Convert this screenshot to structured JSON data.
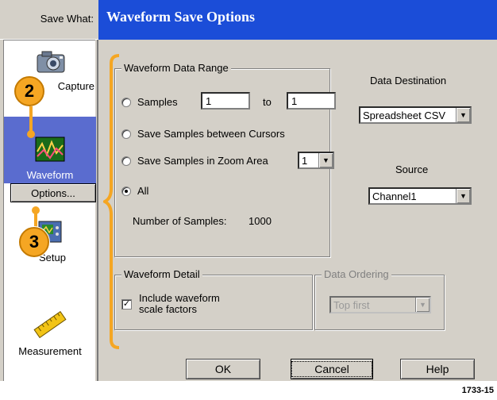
{
  "left_panel": {
    "save_what_label": "Save What:",
    "items": [
      {
        "label": "Capture",
        "icon": "camera-icon"
      },
      {
        "label": "Waveform",
        "icon": "waveform-icon"
      },
      {
        "label": "Setup",
        "icon": "setup-icon"
      },
      {
        "label": "Measurement",
        "icon": "ruler-icon"
      }
    ],
    "options_button": "Options..."
  },
  "dialog": {
    "title": "Waveform Save Options",
    "range_group": {
      "title": "Waveform Data Range",
      "samples_label": "Samples",
      "samples_from": "1",
      "to_label": "to",
      "samples_to": "1",
      "between_cursors": "Save Samples between Cursors",
      "zoom_area": "Save Samples in Zoom Area",
      "zoom_value": "1",
      "all_label": "All",
      "num_samples_label": "Number of Samples:",
      "num_samples_value": "1000"
    },
    "destination_label": "Data Destination",
    "destination_value": "Spreadsheet CSV",
    "source_label": "Source",
    "source_value": "Channel1",
    "detail_group": {
      "title": "Waveform Detail",
      "include_scale_line1": "Include waveform",
      "include_scale_line2": "scale factors",
      "checked": true
    },
    "ordering_group": {
      "title": "Data Ordering",
      "value": "Top first"
    },
    "buttons": {
      "ok": "OK",
      "cancel": "Cancel",
      "help": "Help"
    }
  },
  "callouts": {
    "step2": "2",
    "step3": "3"
  },
  "figure_id": "1733-15",
  "colors": {
    "accent": "#1b4dd8",
    "callout": "#f5a623",
    "panel": "#d4d0c8"
  }
}
